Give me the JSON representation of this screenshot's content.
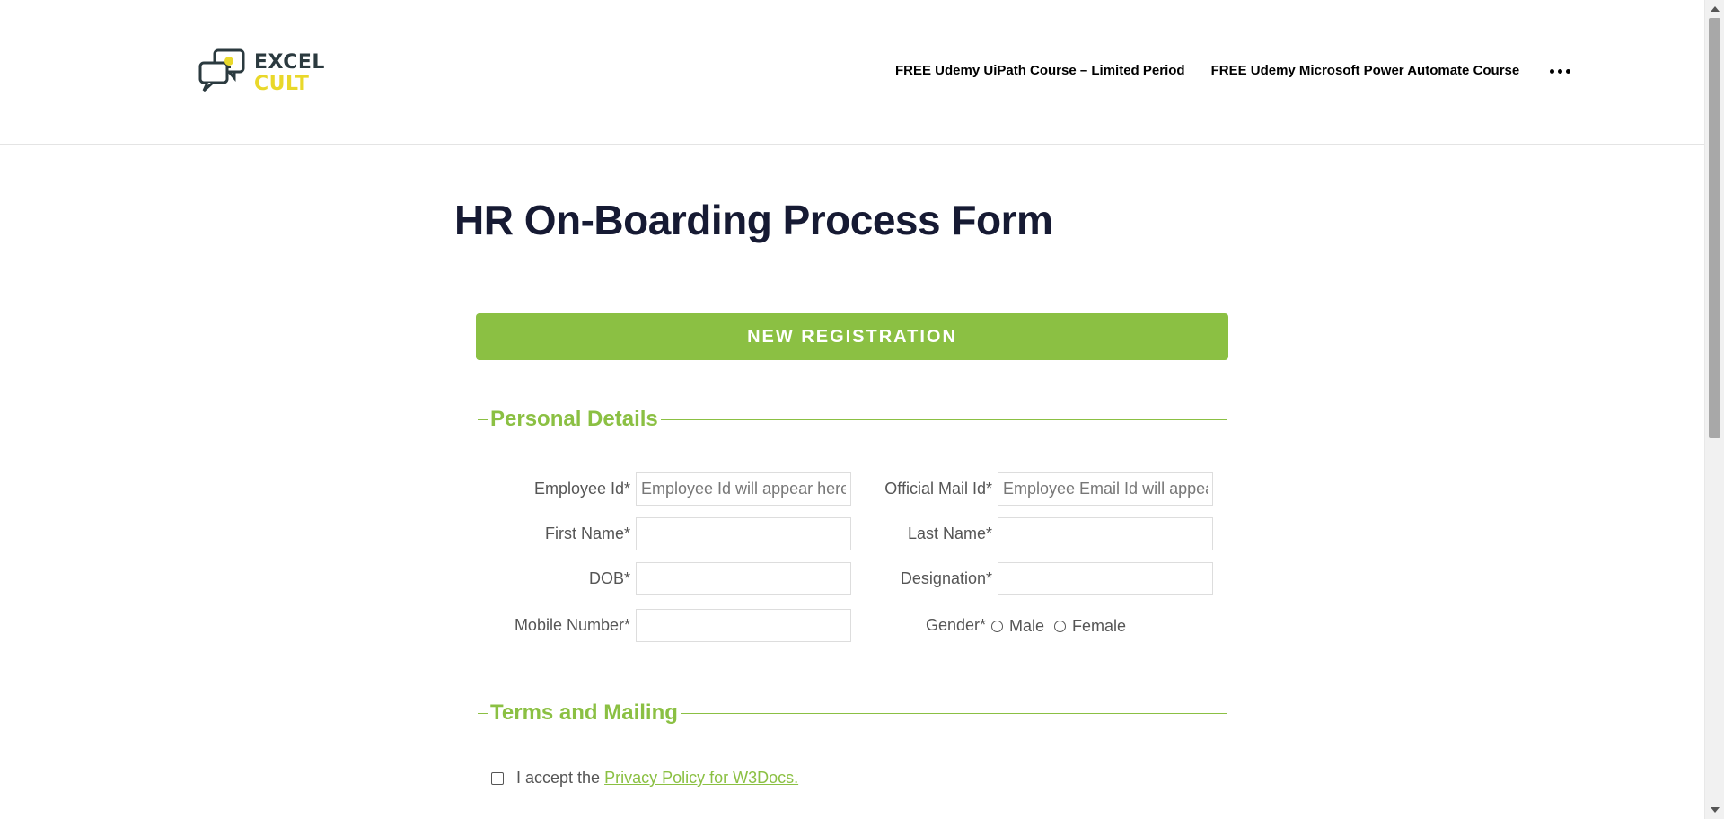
{
  "logo": {
    "line1": "EXCEL",
    "line2": "CULT"
  },
  "nav": {
    "items": [
      "FREE Udemy UiPath Course – Limited Period",
      "FREE Udemy Microsoft Power Automate Course"
    ]
  },
  "page": {
    "title": "HR On-Boarding Process Form"
  },
  "banner": {
    "label": "NEW REGISTRATION"
  },
  "personal": {
    "legend": "Personal Details",
    "employee_id_label": "Employee Id*",
    "employee_id_placeholder": "Employee Id will appear here",
    "official_mail_label": "Official Mail Id*",
    "official_mail_placeholder": "Employee Email Id will appear",
    "first_name_label": "First Name*",
    "last_name_label": "Last Name*",
    "dob_label": "DOB*",
    "designation_label": "Designation*",
    "mobile_label": "Mobile Number*",
    "gender_label": "Gender*",
    "gender_options": [
      "Male",
      "Female"
    ]
  },
  "terms": {
    "legend": "Terms and Mailing",
    "accept_prefix": "I accept the",
    "privacy_link": "Privacy Policy for W3Docs."
  },
  "colors": {
    "accent": "#8bc043",
    "title": "#161a33",
    "logo_dark": "#2b3a3f",
    "logo_yellow": "#e9d82a"
  }
}
